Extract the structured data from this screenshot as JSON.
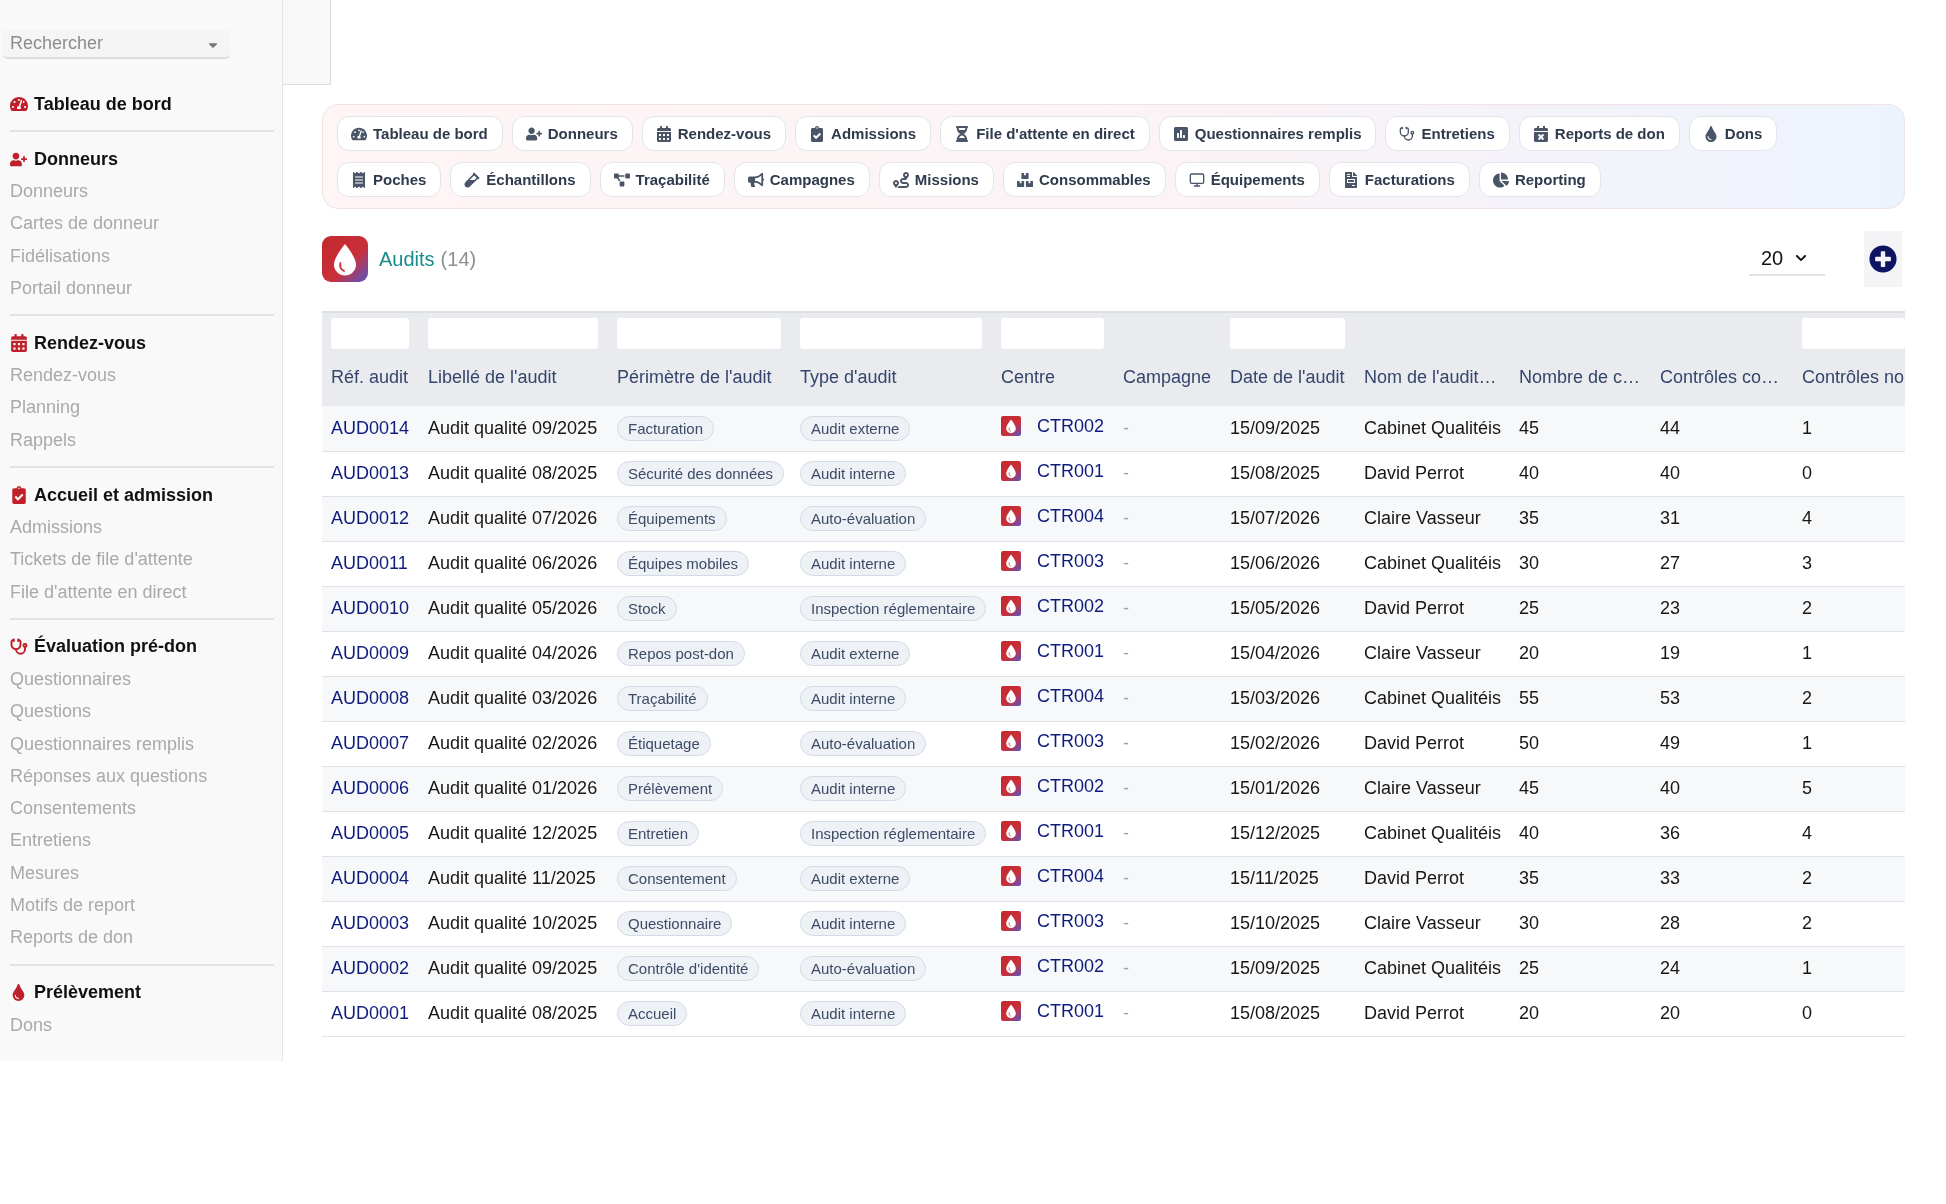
{
  "sidebar": {
    "search": {
      "placeholder": "Rechercher"
    },
    "sections": [
      {
        "title": "Tableau de bord"
      },
      {
        "title": "Donneurs",
        "items": [
          "Donneurs",
          "Cartes de donneur",
          "Fidélisations",
          "Portail donneur"
        ]
      },
      {
        "title": "Rendez-vous",
        "items": [
          "Rendez-vous",
          "Planning",
          "Rappels"
        ]
      },
      {
        "title": "Accueil et admission",
        "items": [
          "Admissions",
          "Tickets de file d'attente",
          "File d'attente en direct"
        ]
      },
      {
        "title": "Évaluation pré-don",
        "items": [
          "Questionnaires",
          "Questions",
          "Questionnaires remplis",
          "Réponses aux questions",
          "Consentements",
          "Entretiens",
          "Mesures",
          "Motifs de report",
          "Reports de don"
        ]
      },
      {
        "title": "Prélèvement",
        "items": [
          "Dons"
        ]
      }
    ]
  },
  "tab_rows": [
    {
      "tabs": [
        {
          "label": "Tableau de bord"
        },
        {
          "label": "Donneurs"
        },
        {
          "label": "Rendez-vous"
        },
        {
          "label": "Admissions"
        },
        {
          "label": "File d'attente en direct"
        },
        {
          "label": "Questionnaires remplis"
        },
        {
          "label": "Entretiens"
        },
        {
          "label": "Reports de don"
        },
        {
          "label": "Dons"
        }
      ]
    },
    {
      "tabs": [
        {
          "label": "Poches"
        },
        {
          "label": "Échantillons"
        },
        {
          "label": "Traçabilité"
        },
        {
          "label": "Campagnes"
        },
        {
          "label": "Missions"
        },
        {
          "label": "Consommables"
        },
        {
          "label": "Équipements"
        },
        {
          "label": "Facturations"
        },
        {
          "label": "Reporting"
        }
      ]
    }
  ],
  "list_header": {
    "title": "Audits",
    "count": "(14)",
    "page_size": "20"
  },
  "table": {
    "columns": [
      {
        "label": "Réf. audit",
        "filter": true,
        "kind": "link"
      },
      {
        "label": "Libellé de l'audit",
        "filter": true,
        "kind": "text"
      },
      {
        "label": "Périmètre de l'audit",
        "filter": true,
        "kind": "badge"
      },
      {
        "label": "Type d'audit",
        "filter": true,
        "kind": "badge"
      },
      {
        "label": "Centre",
        "filter": true,
        "kind": "centre"
      },
      {
        "label": "Campagne",
        "filter": false,
        "kind": "muted"
      },
      {
        "label": "Date de l'audit",
        "filter": true,
        "kind": "text"
      },
      {
        "label": "Nom de l'audit…",
        "filter": false,
        "kind": "text"
      },
      {
        "label": "Nombre de c…",
        "filter": false,
        "kind": "text"
      },
      {
        "label": "Contrôles co…",
        "filter": false,
        "kind": "text"
      },
      {
        "label": "Contrôles no",
        "filter": true,
        "kind": "text"
      }
    ],
    "rows": [
      [
        "AUD0014",
        "Audit qualité 09/2025",
        "Facturation",
        "Audit externe",
        "CTR002",
        "-",
        "15/09/2025",
        "Cabinet Qualitéis",
        "45",
        "44",
        "1"
      ],
      [
        "AUD0013",
        "Audit qualité 08/2025",
        "Sécurité des données",
        "Audit interne",
        "CTR001",
        "-",
        "15/08/2025",
        "David Perrot",
        "40",
        "40",
        "0"
      ],
      [
        "AUD0012",
        "Audit qualité 07/2026",
        "Équipements",
        "Auto-évaluation",
        "CTR004",
        "-",
        "15/07/2026",
        "Claire Vasseur",
        "35",
        "31",
        "4"
      ],
      [
        "AUD0011",
        "Audit qualité 06/2026",
        "Équipes mobiles",
        "Audit interne",
        "CTR003",
        "-",
        "15/06/2026",
        "Cabinet Qualitéis",
        "30",
        "27",
        "3"
      ],
      [
        "AUD0010",
        "Audit qualité 05/2026",
        "Stock",
        "Inspection réglementaire",
        "CTR002",
        "-",
        "15/05/2026",
        "David Perrot",
        "25",
        "23",
        "2"
      ],
      [
        "AUD0009",
        "Audit qualité 04/2026",
        "Repos post-don",
        "Audit externe",
        "CTR001",
        "-",
        "15/04/2026",
        "Claire Vasseur",
        "20",
        "19",
        "1"
      ],
      [
        "AUD0008",
        "Audit qualité 03/2026",
        "Traçabilité",
        "Audit interne",
        "CTR004",
        "-",
        "15/03/2026",
        "Cabinet Qualitéis",
        "55",
        "53",
        "2"
      ],
      [
        "AUD0007",
        "Audit qualité 02/2026",
        "Étiquetage",
        "Auto-évaluation",
        "CTR003",
        "-",
        "15/02/2026",
        "David Perrot",
        "50",
        "49",
        "1"
      ],
      [
        "AUD0006",
        "Audit qualité 01/2026",
        "Prélèvement",
        "Audit interne",
        "CTR002",
        "-",
        "15/01/2026",
        "Claire Vasseur",
        "45",
        "40",
        "5"
      ],
      [
        "AUD0005",
        "Audit qualité 12/2025",
        "Entretien",
        "Inspection réglementaire",
        "CTR001",
        "-",
        "15/12/2025",
        "Cabinet Qualitéis",
        "40",
        "36",
        "4"
      ],
      [
        "AUD0004",
        "Audit qualité 11/2025",
        "Consentement",
        "Audit externe",
        "CTR004",
        "-",
        "15/11/2025",
        "David Perrot",
        "35",
        "33",
        "2"
      ],
      [
        "AUD0003",
        "Audit qualité 10/2025",
        "Questionnaire",
        "Audit interne",
        "CTR003",
        "-",
        "15/10/2025",
        "Claire Vasseur",
        "30",
        "28",
        "2"
      ],
      [
        "AUD0002",
        "Audit qualité 09/2025",
        "Contrôle d'identité",
        "Auto-évaluation",
        "CTR002",
        "-",
        "15/09/2025",
        "Cabinet Qualitéis",
        "25",
        "24",
        "1"
      ],
      [
        "AUD0001",
        "Audit qualité 08/2025",
        "Accueil",
        "Audit interne",
        "CTR001",
        "-",
        "15/08/2025",
        "David Perrot",
        "20",
        "20",
        "0"
      ]
    ]
  }
}
